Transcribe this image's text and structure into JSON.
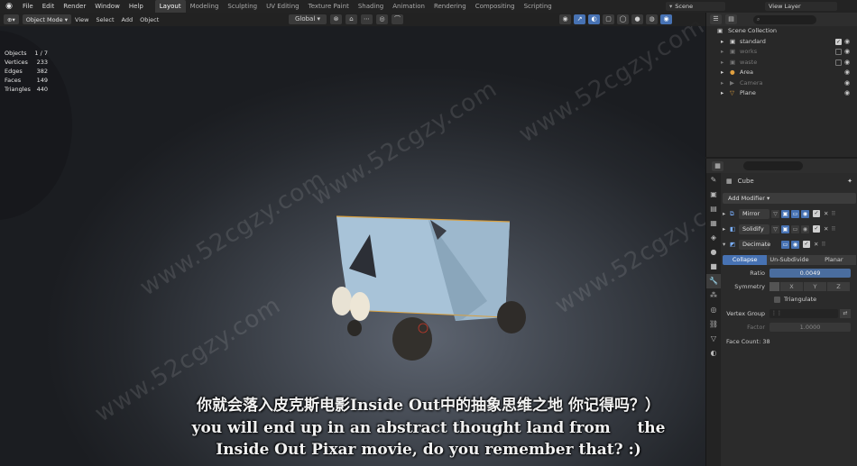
{
  "menu": {
    "items": [
      "File",
      "Edit",
      "Render",
      "Window",
      "Help"
    ]
  },
  "workspaces": {
    "tabs": [
      "Layout",
      "Modeling",
      "Sculpting",
      "UV Editing",
      "Texture Paint",
      "Shading",
      "Animation",
      "Rendering",
      "Compositing",
      "Scripting"
    ],
    "active": "Layout"
  },
  "scene": {
    "name": "Scene",
    "view_layer": "View Layer"
  },
  "viewport": {
    "mode": "Object Mode",
    "menus": [
      "View",
      "Select",
      "Add",
      "Object"
    ],
    "transform_orientation": "Global",
    "stats": [
      {
        "label": "Objects",
        "value": "1 / 7"
      },
      {
        "label": "Vertices",
        "value": "233"
      },
      {
        "label": "Edges",
        "value": "382"
      },
      {
        "label": "Faces",
        "value": "149"
      },
      {
        "label": "Triangles",
        "value": "440"
      }
    ]
  },
  "outliner": {
    "root": "Scene Collection",
    "items": [
      {
        "name": "standard",
        "checked": true,
        "visible": true,
        "dim": false
      },
      {
        "name": "works",
        "checked": false,
        "visible": true,
        "dim": true
      },
      {
        "name": "waste",
        "checked": false,
        "visible": true,
        "dim": true
      },
      {
        "name": "Area",
        "visible": true,
        "dim": false
      },
      {
        "name": "Camera",
        "visible": true,
        "dim": true
      },
      {
        "name": "Plane",
        "visible": true,
        "dim": false
      }
    ]
  },
  "properties": {
    "object_name": "Cube",
    "add_modifier": "Add Modifier",
    "modifiers": [
      {
        "name": "Mirror",
        "expanded": false
      },
      {
        "name": "Solidify",
        "expanded": false
      },
      {
        "name": "Decimate",
        "expanded": true
      }
    ],
    "decimate": {
      "modes": [
        "Collapse",
        "Un-Subdivide",
        "Planar"
      ],
      "active_mode": "Collapse",
      "ratio_label": "Ratio",
      "ratio": "0.0049",
      "symmetry_label": "Symmetry",
      "axes": [
        "X",
        "Y",
        "Z"
      ],
      "triangulate": "Triangulate",
      "vertex_group_label": "Vertex Group",
      "factor_label": "Factor",
      "factor": "1.0000",
      "face_count": "Face Count: 38"
    }
  },
  "watermark": "www.52cgzy.com",
  "subtitles": {
    "cn": "你就会落入皮克斯电影Inside Out中的抽象思维之地 你记得吗？）",
    "en1": "you will end up in an abstract thought land from     the",
    "en2": "Inside Out Pixar movie, do you remember that? :)"
  }
}
